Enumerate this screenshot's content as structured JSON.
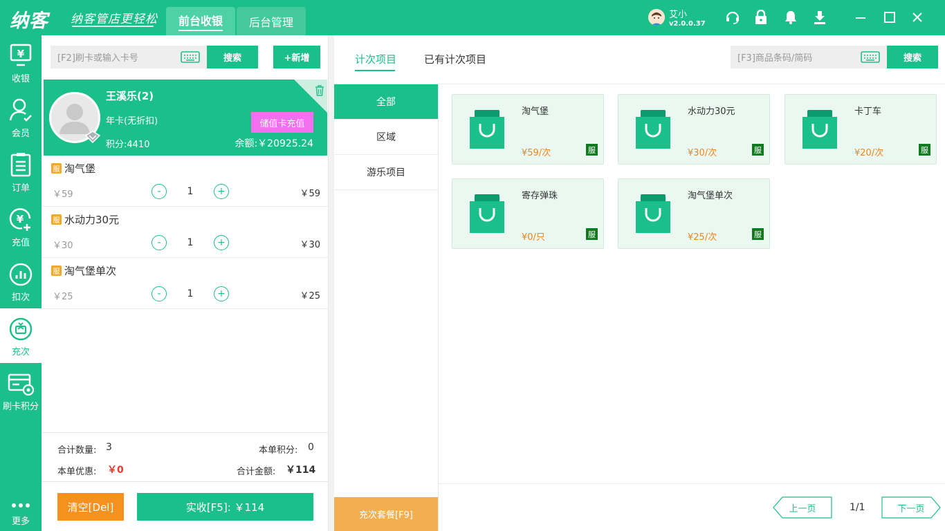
{
  "header": {
    "logo": "纳客",
    "slogan": "纳客管店更轻松",
    "tabs": [
      {
        "label": "前台收银",
        "active": true
      },
      {
        "label": "后台管理",
        "active": false
      }
    ],
    "user_name": "艾小",
    "version": "v2.0.0.37",
    "icons": [
      "headset-icon",
      "lock-icon",
      "bell-icon",
      "download-icon",
      "minimize-icon",
      "maximize-icon",
      "close-icon"
    ]
  },
  "nav": {
    "items": [
      {
        "label": "收银",
        "icon": "cashier-icon"
      },
      {
        "label": "会员",
        "icon": "member-icon"
      },
      {
        "label": "订单",
        "icon": "order-icon"
      },
      {
        "label": "充值",
        "icon": "recharge-icon"
      },
      {
        "label": "扣次",
        "icon": "deduct-icon"
      },
      {
        "label": "充次",
        "icon": "topup-count-icon",
        "active": true
      },
      {
        "label": "刷卡积分",
        "icon": "card-points-icon"
      }
    ],
    "more": "更多"
  },
  "cart": {
    "search_placeholder": "[F2]刷卡或输入卡号",
    "search_button": "搜索",
    "add_button": "+新增",
    "member": {
      "name": "王溪乐(2)",
      "card_type": "年卡(无折扣)",
      "points": "积分:4410",
      "balance": "余额:￥20925.24",
      "recharge_button": "储值卡充值"
    },
    "badge": "服",
    "items": [
      {
        "name": "淘气堡",
        "unit_price": "￥59",
        "qty": "1",
        "total": "￥59"
      },
      {
        "name": "水动力30元",
        "unit_price": "￥30",
        "qty": "1",
        "total": "￥30"
      },
      {
        "name": "淘气堡单次",
        "unit_price": "￥25",
        "qty": "1",
        "total": "￥25"
      }
    ],
    "minus": "-",
    "plus": "+",
    "summary": {
      "count_label": "合计数量:",
      "count": "3",
      "points_label": "本单积分:",
      "points": "0",
      "discount_label": "本单优惠:",
      "discount": "￥0",
      "amount_label": "合计金额:",
      "amount": "￥114"
    },
    "clear_button": "清空[Del]",
    "pay_button": "实收[F5]: ￥114"
  },
  "products": {
    "tabs": [
      {
        "label": "计次项目",
        "active": true
      },
      {
        "label": "已有计次项目",
        "active": false
      }
    ],
    "search_placeholder": "[F3]商品条码/简码",
    "search_button": "搜索",
    "categories": [
      {
        "label": "全部",
        "active": true
      },
      {
        "label": "区域"
      },
      {
        "label": "游乐项目"
      }
    ],
    "package_button": "充次套餐[F9]",
    "badge": "服",
    "cards": [
      {
        "name": "淘气堡",
        "price": "¥59/次"
      },
      {
        "name": "水动力30元",
        "price": "¥30/次"
      },
      {
        "name": "卡丁车",
        "price": "¥20/次"
      },
      {
        "name": "寄存弹珠",
        "price": "¥0/只"
      },
      {
        "name": "淘气堡单次",
        "price": "¥25/次"
      }
    ],
    "pager": {
      "prev": "上一页",
      "page": "1/1",
      "next": "下一页"
    }
  },
  "colors": {
    "brand": "#1bbf8a",
    "orange": "#f5911e",
    "pink": "#f36ef0",
    "price": "#f08519",
    "discount": "#e63b2e"
  }
}
